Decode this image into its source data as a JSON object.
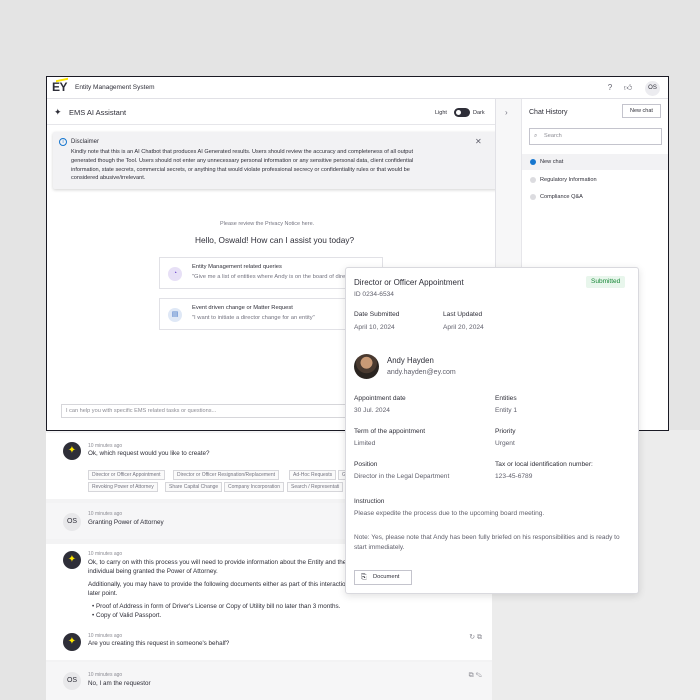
{
  "header": {
    "logo": "EY",
    "app_title": "Entity Management System",
    "avatar": "OS",
    "help_icon": "?",
    "like_icon": "♡"
  },
  "assistant": {
    "title": "EMS AI Assistant",
    "light_label": "Light",
    "dark_label": "Dark",
    "disclaimer_title": "Disclaimer",
    "disclaimer_lines": [
      "Kindly note that this is an AI Chatbot that produces AI Generated results. Users should review the accuracy and completeness of all output",
      "generated though the Tool. Users should not enter any unnecessary personal information or any sensitive personal data, client confidential",
      "information, state secrets, commercial secrets, or anything that would violate professional secrecy or confidentiality rules or that would be",
      "considered abusive/irrelevant."
    ],
    "privacy_notice": "Please review the Privacy Notice here.",
    "greeting": "Hello, Oswald! How can I assist you today?",
    "suggestions": [
      {
        "title": "Entity Management related queries",
        "subtitle": "\"Give me a list of entities where Andy is on the board of directors\""
      },
      {
        "title": "Event driven change or Matter Request",
        "subtitle": "\"I want to initiate a director change for an entity\""
      }
    ],
    "input_placeholder": "I can help you with specific EMS related tasks or questions..."
  },
  "chat_history": {
    "title": "Chat History",
    "new_chat_label": "New chat",
    "search_placeholder": "Search",
    "items": [
      "New chat",
      "Regulatory Information",
      "Compliance Q&A"
    ]
  },
  "messages": [
    {
      "time": "10 minutes ago",
      "text": "Ok, which request would you like to create?"
    },
    {
      "time": "10 minutes ago",
      "text": "Granting Power of Attorney",
      "avatar": "OS"
    },
    {
      "time": "10 minutes ago",
      "lines": [
        "Ok, to carry on with this process you will need to provide information about the Entity and the",
        "individual being granted the Power of Attorney.",
        "Additionally, you may have to provide the following documents either as part of this interaction",
        "later point.",
        "•  Proof of Address in form of Driver's License or Copy of Utility bill no later than 3 months.",
        "•  Copy of Valid Passport."
      ]
    },
    {
      "time": "10 minutes ago",
      "text": "Are you creating this request in someone's behalf?"
    },
    {
      "time": "10 minutes ago",
      "text": "No, I am the requestor",
      "avatar": "OS"
    }
  ],
  "chips_row1": [
    "Director or Officer Appointment",
    "Director or Officer Resignation/Replacement",
    "Ad-Hoc Requests",
    "G"
  ],
  "chips_row2": [
    "Revoking Power of Attorney",
    "Share Capital Change",
    "Company Incorporation",
    "Search / Representati"
  ],
  "card": {
    "title": "Director or Officer Appointment",
    "id": "ID 0234-6534",
    "status": "Submitted",
    "status_color": "#168736",
    "date_submitted_label": "Date Submitted",
    "date_submitted": "April 10, 2024",
    "last_updated_label": "Last Updated",
    "last_updated": "April 20, 2024",
    "person_name": "Andy Hayden",
    "person_email": "andy.hayden@ey.com",
    "appointment_date_label": "Appointment date",
    "appointment_date": "30 Jul. 2024",
    "entities_label": "Entities",
    "entities": "Entity 1",
    "term_label": "Term of the appointment",
    "term": "Limited",
    "priority_label": "Priority",
    "priority": "Urgent",
    "position_label": "Position",
    "position": "Director in the Legal Department",
    "tax_label": "Tax or local identification number:",
    "tax": "123-45-6789",
    "instruction_label": "Instruction",
    "instruction": "Please expedite the process due to the upcoming board meeting.",
    "note": "Note:  Yes, please note that Andy has been fully briefed on his responsibilities and is ready to start immediately.",
    "document_label": "Document"
  },
  "colors": {
    "accent_yellow": "#ffe600",
    "link_blue": "#1777cf",
    "text_dark": "#2e2e38"
  }
}
